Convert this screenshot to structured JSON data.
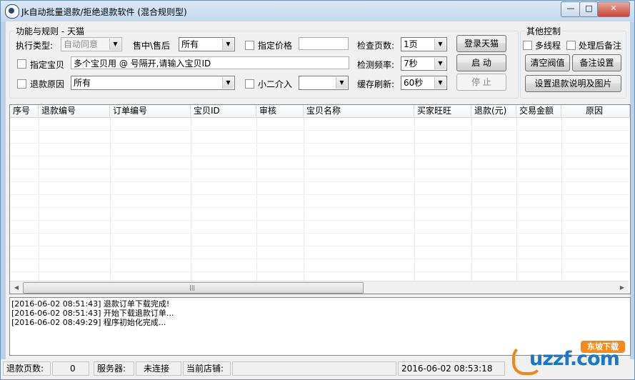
{
  "window": {
    "title": "Jk自动批量退款/拒绝退款软件 (混合规则型)",
    "minimize": "—",
    "maximize": "□",
    "close": "✕"
  },
  "rules": {
    "legend": "功能与规则 - 天猫",
    "exec_type_label": "执行类型:",
    "exec_type_value": "自动同意",
    "sale_label": "售中\\售后",
    "sale_value": "所有",
    "price_label": "指定价格",
    "price_value": "",
    "item_label": "指定宝贝",
    "item_value": "多个宝贝用 @ 号隔开,请输入宝贝ID",
    "reason_label": "退款原因",
    "reason_value": "所有",
    "xiaoer_label": "小二介入",
    "xiaoer_value": "",
    "pages_label": "检查页数:",
    "pages_value": "1页",
    "freq_label": "检测频率:",
    "freq_value": "7秒",
    "cache_label": "缓存刷新:",
    "cache_value": "60秒",
    "login_button": "登录天猫",
    "start_button": "启 动",
    "stop_button": "停 止"
  },
  "other": {
    "legend": "其他控制",
    "multithread_label": "多线程",
    "remark_after_label": "处理后备注",
    "clear_threshold_button": "清空阀值",
    "remark_settings_button": "备注设置",
    "refund_note_button": "设置退款说明及图片"
  },
  "table": {
    "columns": [
      "序号",
      "退款编号",
      "订单编号",
      "宝贝ID",
      "审核",
      "宝贝名称",
      "买家旺旺",
      "退款(元)",
      "交易金额",
      "原因"
    ],
    "rows": []
  },
  "log": [
    "[2016-06-02 08:51:43] 退款订单下载完成!",
    "[2016-06-02 08:51:43] 开始下载退款订单...",
    "[2016-06-02 08:49:29] 程序初始化完成..."
  ],
  "status": {
    "refund_pages_label": "退款页数:",
    "refund_pages_value": "0",
    "server_label": "服务器:",
    "server_value": "未连接",
    "shop_label": "当前店铺:",
    "shop_value": "",
    "datetime": "2016-06-02 08:53:18"
  },
  "watermark": {
    "brand": "uzzf.com",
    "badge": "东坡下载"
  }
}
